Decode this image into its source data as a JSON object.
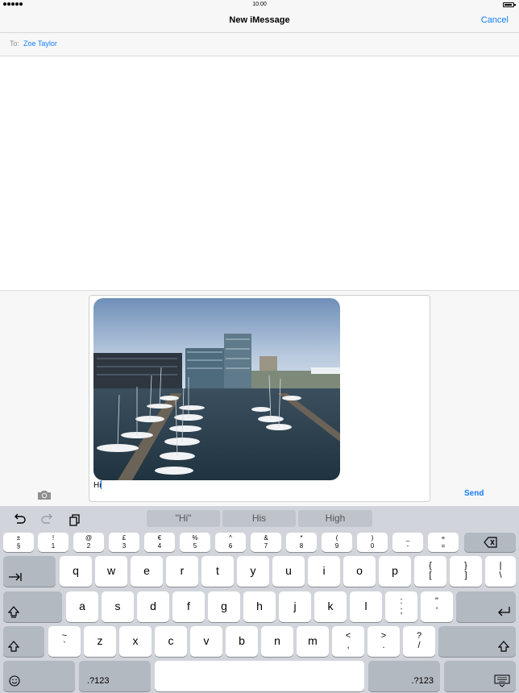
{
  "status_bar": {
    "time": "10:00"
  },
  "nav": {
    "title": "New iMessage",
    "cancel_label": "Cancel"
  },
  "to_field": {
    "label": "To:",
    "recipient": "Zoe Taylor"
  },
  "message": {
    "text": "Hi",
    "send_label": "Send"
  },
  "suggestions": [
    "\"Hi\"",
    "His",
    "High"
  ],
  "keyboard": {
    "number_row": [
      {
        "top": "±",
        "bottom": "§"
      },
      {
        "top": "!",
        "bottom": "1"
      },
      {
        "top": "@",
        "bottom": "2"
      },
      {
        "top": "£",
        "bottom": "3"
      },
      {
        "top": "€",
        "bottom": "4"
      },
      {
        "top": "%",
        "bottom": "5"
      },
      {
        "top": "^",
        "bottom": "6"
      },
      {
        "top": "&",
        "bottom": "7"
      },
      {
        "top": "*",
        "bottom": "8"
      },
      {
        "top": "(",
        "bottom": "9"
      },
      {
        "top": ")",
        "bottom": "0"
      },
      {
        "top": "_",
        "bottom": "-"
      },
      {
        "top": "+",
        "bottom": "="
      }
    ],
    "row1": [
      "q",
      "w",
      "e",
      "r",
      "t",
      "y",
      "u",
      "i",
      "o",
      "p"
    ],
    "row1_symbols": [
      {
        "top": "{",
        "bottom": "["
      },
      {
        "top": "}",
        "bottom": "]"
      },
      {
        "top": "|",
        "bottom": "\\"
      }
    ],
    "row2": [
      "a",
      "s",
      "d",
      "f",
      "g",
      "h",
      "j",
      "k",
      "l"
    ],
    "row2_symbols": [
      {
        "top": ":",
        "bottom": ";"
      },
      {
        "top": "\"",
        "bottom": "'"
      }
    ],
    "row3_first": {
      "top": "~",
      "bottom": "`"
    },
    "row3": [
      "z",
      "x",
      "c",
      "v",
      "b",
      "n",
      "m"
    ],
    "row3_symbols": [
      {
        "top": "<",
        "bottom": ","
      },
      {
        "top": ">",
        "bottom": "."
      },
      {
        "top": "?",
        "bottom": "/"
      }
    ],
    "numbers_label": ".?123"
  },
  "icons": {
    "undo": "undo-icon",
    "redo": "redo-icon",
    "paste": "paste-icon",
    "camera": "camera-icon",
    "delete": "delete-icon",
    "tab": "tab-icon",
    "caps": "caps-lock-icon",
    "return": "return-icon",
    "shift": "shift-icon",
    "emoji": "emoji-icon",
    "hide_keyboard": "hide-keyboard-icon"
  },
  "colors": {
    "accent": "#157efb",
    "keyboard_bg": "#d1d5db",
    "key_dark": "#b3b9c1"
  }
}
